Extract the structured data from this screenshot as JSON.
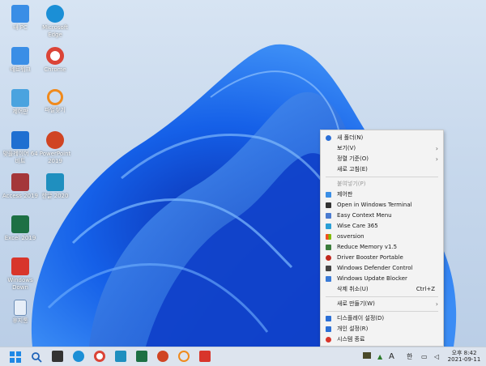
{
  "desktop": {
    "icons": [
      {
        "label": "내 PC",
        "icon": "computer-icon",
        "color": "#3a8ee6"
      },
      {
        "label": "Microsoft Edge",
        "icon": "edge-icon",
        "color": "#1b8fd6"
      },
      {
        "label": "네트워크",
        "icon": "network-icon",
        "color": "#3a8ee6"
      },
      {
        "label": "Chrome",
        "icon": "chrome-icon",
        "color": "#db4437"
      },
      {
        "label": "제어판",
        "icon": "control-panel-icon",
        "color": "#4aa3df"
      },
      {
        "label": "파일찾기",
        "icon": "search-file-icon",
        "color": "#f08a1c"
      },
      {
        "label": "맞플레이어 64 비트",
        "icon": "potplayer-icon",
        "color": "#1f6fd1"
      },
      {
        "label": "PowerPoint 2019",
        "icon": "powerpoint-icon",
        "color": "#d04423"
      },
      {
        "label": "Access 2019",
        "icon": "access-icon",
        "color": "#a4373a"
      },
      {
        "label": "한글 2020",
        "icon": "hangul-icon",
        "color": "#1f8fbf"
      },
      {
        "label": "Excel 2019",
        "icon": "excel-icon",
        "color": "#1d7044"
      },
      {
        "label": "Windows Down",
        "icon": "power-icon",
        "color": "#d8352b"
      },
      {
        "label": "휴지통",
        "icon": "recycle-bin-icon",
        "color": "#6b8cb5"
      }
    ]
  },
  "context_menu": {
    "items": [
      {
        "label": "새 폴더(N)",
        "icon": "new-folder-icon",
        "color": "#2b6fd6",
        "shortcut": "",
        "submenu": false,
        "disabled": false
      },
      {
        "label": "보기(V)",
        "icon": "",
        "color": "",
        "shortcut": "",
        "submenu": true,
        "disabled": false
      },
      {
        "label": "정렬 기준(O)",
        "icon": "",
        "color": "",
        "shortcut": "",
        "submenu": true,
        "disabled": false
      },
      {
        "label": "새로 고침(E)",
        "icon": "",
        "color": "",
        "shortcut": "",
        "submenu": false,
        "disabled": false
      },
      {
        "label": "붙여넣기(P)",
        "icon": "",
        "color": "",
        "shortcut": "",
        "submenu": false,
        "disabled": true
      },
      {
        "label": "제어판",
        "icon": "control-panel-icon",
        "color": "#3a8ee6",
        "shortcut": "",
        "submenu": false,
        "disabled": false
      },
      {
        "label": "Open in Windows Terminal",
        "icon": "terminal-icon",
        "color": "#333333",
        "shortcut": "",
        "submenu": false,
        "disabled": false
      },
      {
        "label": "Easy Context Menu",
        "icon": "context-menu-icon",
        "color": "#4a7bd0",
        "shortcut": "",
        "submenu": false,
        "disabled": false
      },
      {
        "label": "Wise Care 365",
        "icon": "wise-care-icon",
        "color": "#2a9fd6",
        "shortcut": "",
        "submenu": false,
        "disabled": false
      },
      {
        "label": "osversion",
        "icon": "windows-logo-icon",
        "color": "#f2a900",
        "shortcut": "",
        "submenu": false,
        "disabled": false
      },
      {
        "label": "Reduce Memory v1.5",
        "icon": "memory-icon",
        "color": "#3c7d3c",
        "shortcut": "",
        "submenu": false,
        "disabled": false
      },
      {
        "label": "Driver Booster Portable",
        "icon": "driver-booster-icon",
        "color": "#c0281e",
        "shortcut": "",
        "submenu": false,
        "disabled": false
      },
      {
        "label": "Windows Defender Control",
        "icon": "shield-icon",
        "color": "#444444",
        "shortcut": "",
        "submenu": false,
        "disabled": false
      },
      {
        "label": "Windows Update Blocker",
        "icon": "update-blocker-icon",
        "color": "#3a7ad6",
        "shortcut": "",
        "submenu": false,
        "disabled": false
      },
      {
        "label": "삭제 취소(U)",
        "icon": "",
        "color": "",
        "shortcut": "Ctrl+Z",
        "submenu": false,
        "disabled": false
      },
      {
        "label": "새로 만들기(W)",
        "icon": "",
        "color": "",
        "shortcut": "",
        "submenu": true,
        "disabled": false
      },
      {
        "label": "디스플레이 설정(D)",
        "icon": "display-icon",
        "color": "#2b6fd6",
        "shortcut": "",
        "submenu": false,
        "disabled": false
      },
      {
        "label": "개인 설정(R)",
        "icon": "personalize-icon",
        "color": "#2b6fd6",
        "shortcut": "",
        "submenu": false,
        "disabled": false
      },
      {
        "label": "시스템 종료",
        "icon": "power-icon",
        "color": "#d8352b",
        "shortcut": "",
        "submenu": false,
        "disabled": false
      }
    ]
  },
  "taskbar": {
    "buttons": [
      {
        "icon": "start-icon",
        "color": "#1e88e5"
      },
      {
        "icon": "search-icon",
        "color": "#1e63b8"
      },
      {
        "icon": "task-view-icon",
        "color": "#333333"
      },
      {
        "icon": "edge-icon",
        "color": "#1b8fd6"
      },
      {
        "icon": "chrome-icon",
        "color": "#db4437"
      },
      {
        "icon": "hangul-icon",
        "color": "#1f8fbf"
      },
      {
        "icon": "excel-icon",
        "color": "#1d7044"
      },
      {
        "icon": "powerpoint-icon",
        "color": "#d04423"
      },
      {
        "icon": "search-file-icon",
        "color": "#f08a1c"
      },
      {
        "icon": "power-icon",
        "color": "#d8352b"
      }
    ],
    "tray": {
      "ime_mode": "A",
      "ime_lang": "한",
      "clock_period_time": "오후 8:42",
      "clock_date": "2021-09-11"
    }
  }
}
